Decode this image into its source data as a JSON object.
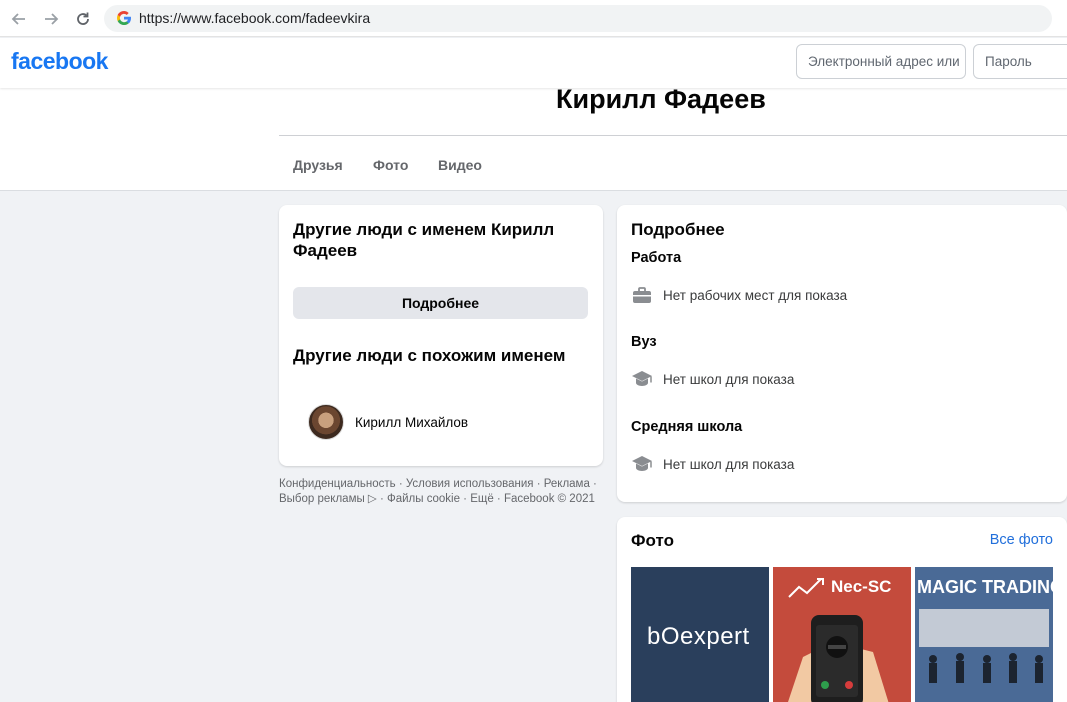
{
  "browser": {
    "url": "https://www.facebook.com/fadeevkira"
  },
  "topbar": {
    "logo": "facebook",
    "email_placeholder": "Электронный адрес или",
    "password_placeholder": "Пароль"
  },
  "profile": {
    "name": "Кирилл Фадеев",
    "tabs": [
      {
        "label": "Друзья"
      },
      {
        "label": "Фото"
      },
      {
        "label": "Видео"
      }
    ]
  },
  "left_card": {
    "others_title": "Другие люди с именем Кирилл Фадеев",
    "more_button": "Подробнее",
    "similar_title": "Другие люди с похожим именем",
    "people": [
      {
        "name": "Кирилл Михайлов"
      }
    ]
  },
  "footer": {
    "text": "Конфиденциальность · Условия использования · Реклама · Выбор рекламы ▷ · Файлы cookie · Ещё · Facebook © 2021"
  },
  "details": {
    "title": "Подробнее",
    "work_heading": "Работа",
    "work_text": "Нет рабочих мест для показа",
    "uni_heading": "Вуз",
    "uni_text": "Нет школ для показа",
    "school_heading": "Средняя школа",
    "school_text": "Нет школ для показа"
  },
  "photos": {
    "title": "Фото",
    "all_link": "Все фото",
    "items": [
      {
        "caption": "bOexpert"
      },
      {
        "caption": "Nec-SC"
      },
      {
        "caption": "MAGIC TRADING SCAM"
      }
    ]
  },
  "colors": {
    "brand": "#1877f2",
    "link": "#216fdb",
    "page_bg": "#f0f2f5"
  }
}
